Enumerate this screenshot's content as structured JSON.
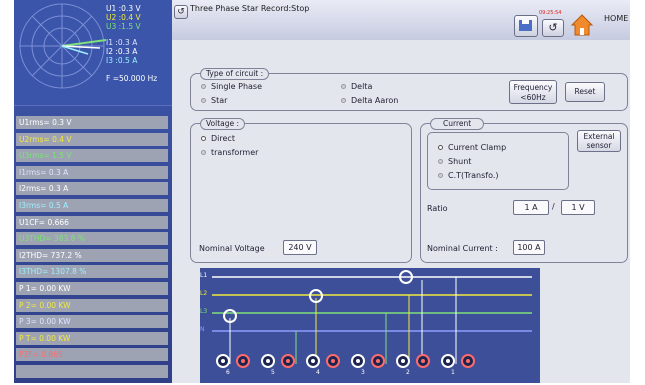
{
  "scope": {
    "u1": "U1 :0.3  V",
    "u2": "U2 :0.4  V",
    "u3": "U3 :1.5  V",
    "i1": "I1 :0.3  A",
    "i2": "I2 :0.3  A",
    "i3": "I3 :0.5  A",
    "freq": "F  =50.000 Hz"
  },
  "measurements": [
    {
      "text": "U1rms=  0.3  V",
      "color": "#ffffff"
    },
    {
      "text": "U2rms=  0.4  V",
      "color": "#f2ea3c"
    },
    {
      "text": "U3rms=  1.5  V",
      "color": "#7ee07a"
    },
    {
      "text": "I1rms=  0.3  A",
      "color": "#dfe3ff"
    },
    {
      "text": "I2rms=  0.3  A",
      "color": "#ffffff"
    },
    {
      "text": "I3rms=  0.5  A",
      "color": "#9cf0ff"
    },
    {
      "text": "U1CF=  0.666",
      "color": "#ffffff"
    },
    {
      "text": "U3THD=  383.8  %",
      "color": "#7ee07a"
    },
    {
      "text": "I2THD=  737.2  %",
      "color": "#ffffff"
    },
    {
      "text": "I3THD=  1307.8  %",
      "color": "#9cf0ff"
    },
    {
      "text": "P 1=  0.00  KW",
      "color": "#ffffff"
    },
    {
      "text": "P 2=  0.00  KW",
      "color": "#f2ea3c"
    },
    {
      "text": "P 3=  0.00  KW",
      "color": "#dfe3ff"
    },
    {
      "text": "P T=  0.00  KW",
      "color": "#f2ea3c"
    },
    {
      "text": "P3F=  0.865",
      "color": "#ff6b6b"
    },
    {
      "text": "",
      "color": "#ffffff"
    }
  ],
  "topbar": {
    "title": "Three Phase Star Record:Stop",
    "clock": "09:25:54",
    "home": "HOME"
  },
  "circuit": {
    "legend": "Type of circuit :",
    "options": [
      "Single Phase",
      "Star",
      "Delta",
      "Delta Aaron"
    ],
    "frequency": "Frequency\n<60Hz",
    "reset": "Reset"
  },
  "voltage": {
    "legend": "Voltage :",
    "options": [
      "Direct",
      "transformer"
    ],
    "nominal_label": "Nominal Voltage",
    "nominal_value": "240 V"
  },
  "current": {
    "legend": "Current",
    "options": [
      "Current Clamp",
      "Shunt",
      "C.T(Transfo.)"
    ],
    "external": "External\nsensor",
    "ratio_label": "Ratio",
    "ratio_a": "1 A",
    "ratio_sep": "/",
    "ratio_b": "1 V",
    "nominal_label": "Nominal Current :",
    "nominal_value": "100 A"
  },
  "wiring": {
    "lines": [
      "L1",
      "L2",
      "L3",
      "N"
    ],
    "terminals": [
      "6",
      "5",
      "4",
      "3",
      "2",
      "1"
    ]
  }
}
